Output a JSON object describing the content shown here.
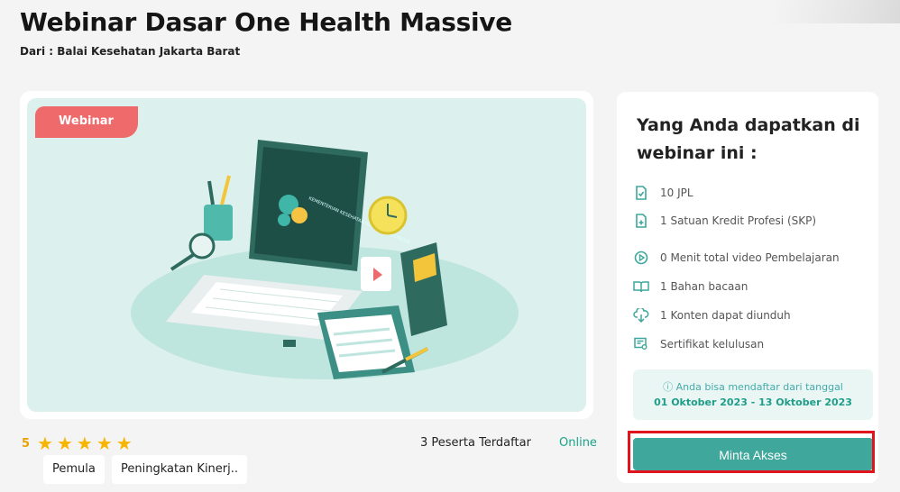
{
  "header": {
    "title": "Webinar Dasar One Health Massive",
    "subtitle": "Dari : Balai Kesehatan Jakarta Barat"
  },
  "hero": {
    "badge": "Webinar",
    "illustration_caption": "KEMENTERIAN KESEHATAN REPUBLIK INDONESIA",
    "tags": [
      "Pemula",
      "Peningkatan Kinerj.."
    ]
  },
  "meta": {
    "rating": "5",
    "stars": 5,
    "participants": "3 Peserta Terdaftar",
    "status": "Online"
  },
  "side": {
    "title": "Yang Anda dapatkan di webinar ini :",
    "benefits": [
      {
        "icon": "document-check-icon",
        "label": "10 JPL"
      },
      {
        "icon": "document-plus-icon",
        "label": "1 Satuan Kredit Profesi (SKP)"
      },
      {
        "icon": "play-circle-icon",
        "label": "0 Menit total video Pembelajaran"
      },
      {
        "icon": "open-book-icon",
        "label": "1 Bahan bacaan"
      },
      {
        "icon": "cloud-download-icon",
        "label": "1 Konten dapat diunduh"
      },
      {
        "icon": "certificate-icon",
        "label": "Sertifikat kelulusan"
      }
    ],
    "info_line1": "ⓘ Anda bisa mendaftar dari tanggal",
    "info_line2": "01 Oktober 2023 - 13 Oktober 2023",
    "cta_label": "Minta Akses"
  },
  "colors": {
    "accent": "#3fa79b",
    "badge": "#ef6a6a",
    "star": "#f7b500",
    "online": "#17a589",
    "highlight": "#e0141c"
  }
}
